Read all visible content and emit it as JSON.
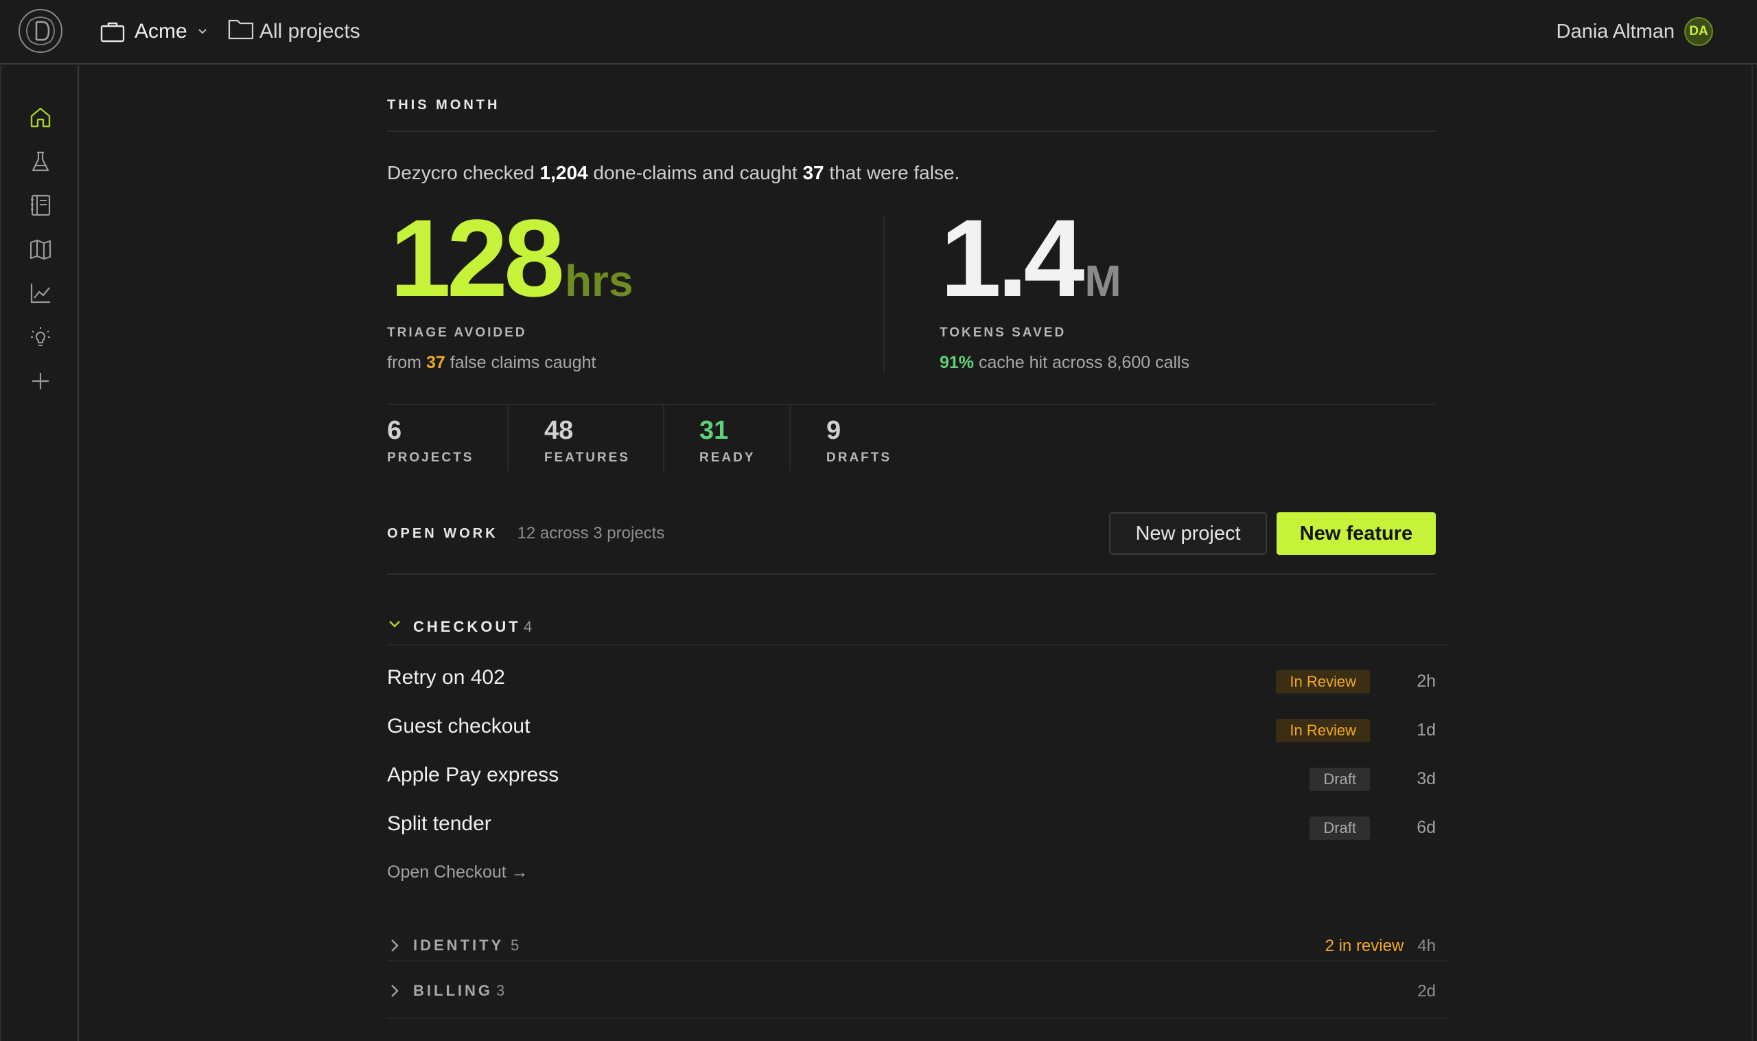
{
  "header": {
    "workspace": "Acme",
    "all_projects": "All projects",
    "user_name": "Dania Altman",
    "user_initials": "DA"
  },
  "sidebar": {
    "items": [
      {
        "icon": "home-icon",
        "active": true
      },
      {
        "icon": "flask-icon"
      },
      {
        "icon": "notebook-icon"
      },
      {
        "icon": "map-icon"
      },
      {
        "icon": "chart-line-icon"
      },
      {
        "icon": "lightbulb-icon"
      },
      {
        "icon": "plus-icon"
      }
    ]
  },
  "main": {
    "section_title": "THIS MONTH",
    "summary": {
      "prefix": "Dezycro checked",
      "checked": "1,204",
      "middle": "done-claims and caught",
      "caught": "37",
      "suffix": "that were false."
    },
    "triage": {
      "value": "128",
      "unit": "hrs",
      "label": "TRIAGE AVOIDED",
      "sub_prefix": "from",
      "sub_value": "37",
      "sub_suffix": "false claims caught"
    },
    "tokens": {
      "value": "1.4",
      "unit": "M",
      "label": "TOKENS SAVED",
      "sub_value": "91%",
      "sub_suffix": "cache hit across 8,600 calls"
    },
    "stats": [
      {
        "value": "6",
        "label": "PROJECTS"
      },
      {
        "value": "48",
        "label": "FEATURES"
      },
      {
        "value": "31",
        "label": "READY",
        "color": "#5fd07a"
      },
      {
        "value": "9",
        "label": "DRAFTS"
      }
    ],
    "open_work": {
      "title": "OPEN WORK",
      "count": "12 across 3 projects",
      "new_project": "New project",
      "new_feature": "New feature"
    },
    "groups": [
      {
        "name": "CHECKOUT",
        "count": "4",
        "expanded": true,
        "items": [
          {
            "title": "Retry on 402",
            "status": "In Review",
            "age": "2h"
          },
          {
            "title": "Guest checkout",
            "status": "In Review",
            "age": "1d"
          },
          {
            "title": "Apple Pay express",
            "status": "Draft",
            "age": "3d"
          },
          {
            "title": "Split tender",
            "status": "Draft",
            "age": "6d"
          }
        ],
        "link": "Open Checkout →"
      },
      {
        "name": "IDENTITY",
        "count": "5",
        "expanded": false,
        "meta": "2 in review",
        "age": "4h"
      },
      {
        "name": "BILLING",
        "count": "3",
        "expanded": false,
        "age": "2d"
      }
    ]
  },
  "colors": {
    "accent": "#c6f23a",
    "accent_dim": "#6e8c22",
    "review": "#f0a928",
    "ready": "#5fd07a",
    "background": "#1b1b1b"
  }
}
